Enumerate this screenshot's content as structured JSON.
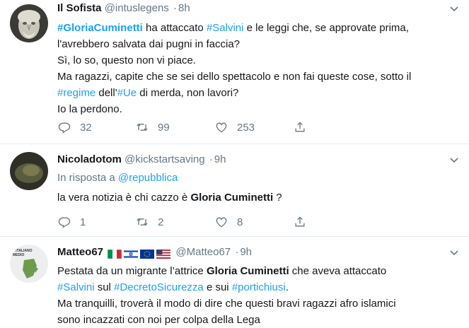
{
  "tweets": [
    {
      "name": "Il Sofista",
      "handle": "@intuslegens",
      "sep": "·",
      "time": "8h",
      "lines": [
        {
          "parts": [
            {
              "t": "#GloriaCuminetti",
              "k": "link-bold"
            },
            {
              "t": " ha attaccato ",
              "k": "text"
            },
            {
              "t": "#Salvini",
              "k": "link"
            },
            {
              "t": " e le leggi che, se approvate prima,",
              "k": "text"
            }
          ]
        },
        {
          "parts": [
            {
              "t": "l'avrebbero salvata dai pugni in faccia?",
              "k": "text"
            }
          ]
        },
        {
          "parts": [
            {
              "t": "Sì, lo so, questo non vi piace.",
              "k": "text"
            }
          ]
        },
        {
          "parts": [
            {
              "t": "Ma ragazzi, capite che se sei dello spettacolo e non fai queste cose, sotto il",
              "k": "text"
            }
          ]
        },
        {
          "parts": [
            {
              "t": "#regime",
              "k": "link"
            },
            {
              "t": " dell'",
              "k": "text"
            },
            {
              "t": "#Ue",
              "k": "link"
            },
            {
              "t": " di merda, non lavori?",
              "k": "text"
            }
          ]
        },
        {
          "parts": [
            {
              "t": "Io la perdono.",
              "k": "text"
            }
          ]
        }
      ],
      "replies": "32",
      "retweets": "99",
      "likes": "253"
    },
    {
      "name": "Nicoladotom",
      "handle": "@kickstartsaving",
      "sep": "·",
      "time": "9h",
      "reply_prefix": "In risposta a",
      "reply_to": "@repubblica",
      "lines": [
        {
          "parts": [
            {
              "t": "la vera notizia è chi cazzo è ",
              "k": "text"
            },
            {
              "t": "Gloria Cuminetti",
              "k": "bold"
            },
            {
              "t": " ?",
              "k": "text"
            }
          ]
        }
      ],
      "replies": "1",
      "retweets": "2",
      "likes": "8"
    },
    {
      "name": "Matteo67",
      "handle": "@Matteo67",
      "sep": "·",
      "time": "9h",
      "avatar_text": "L'ITALIANO MEDIO",
      "lines": [
        {
          "parts": [
            {
              "t": "Pestata da un migrante l’attrice ",
              "k": "text"
            },
            {
              "t": "Gloria Cuminetti",
              "k": "bold"
            },
            {
              "t": " che aveva attaccato",
              "k": "text"
            }
          ]
        },
        {
          "parts": [
            {
              "t": "#Salvini",
              "k": "link"
            },
            {
              "t": " sul ",
              "k": "text"
            },
            {
              "t": "#DecretoSicurezza",
              "k": "link"
            },
            {
              "t": " e sui ",
              "k": "text"
            },
            {
              "t": "#portichiusi",
              "k": "link"
            },
            {
              "t": ".",
              "k": "text"
            }
          ]
        },
        {
          "parts": [
            {
              "t": "Ma tranquilli, troverà il modo di dire che questi bravi ragazzi afro islamici",
              "k": "text"
            }
          ]
        },
        {
          "parts": [
            {
              "t": "sono incazzati con noi per colpa della Lega",
              "k": "text"
            }
          ]
        }
      ]
    }
  ],
  "colors": {
    "link": "#1da1f2",
    "muted": "#657786",
    "text": "#14171a",
    "divider": "#e6ecf0"
  }
}
